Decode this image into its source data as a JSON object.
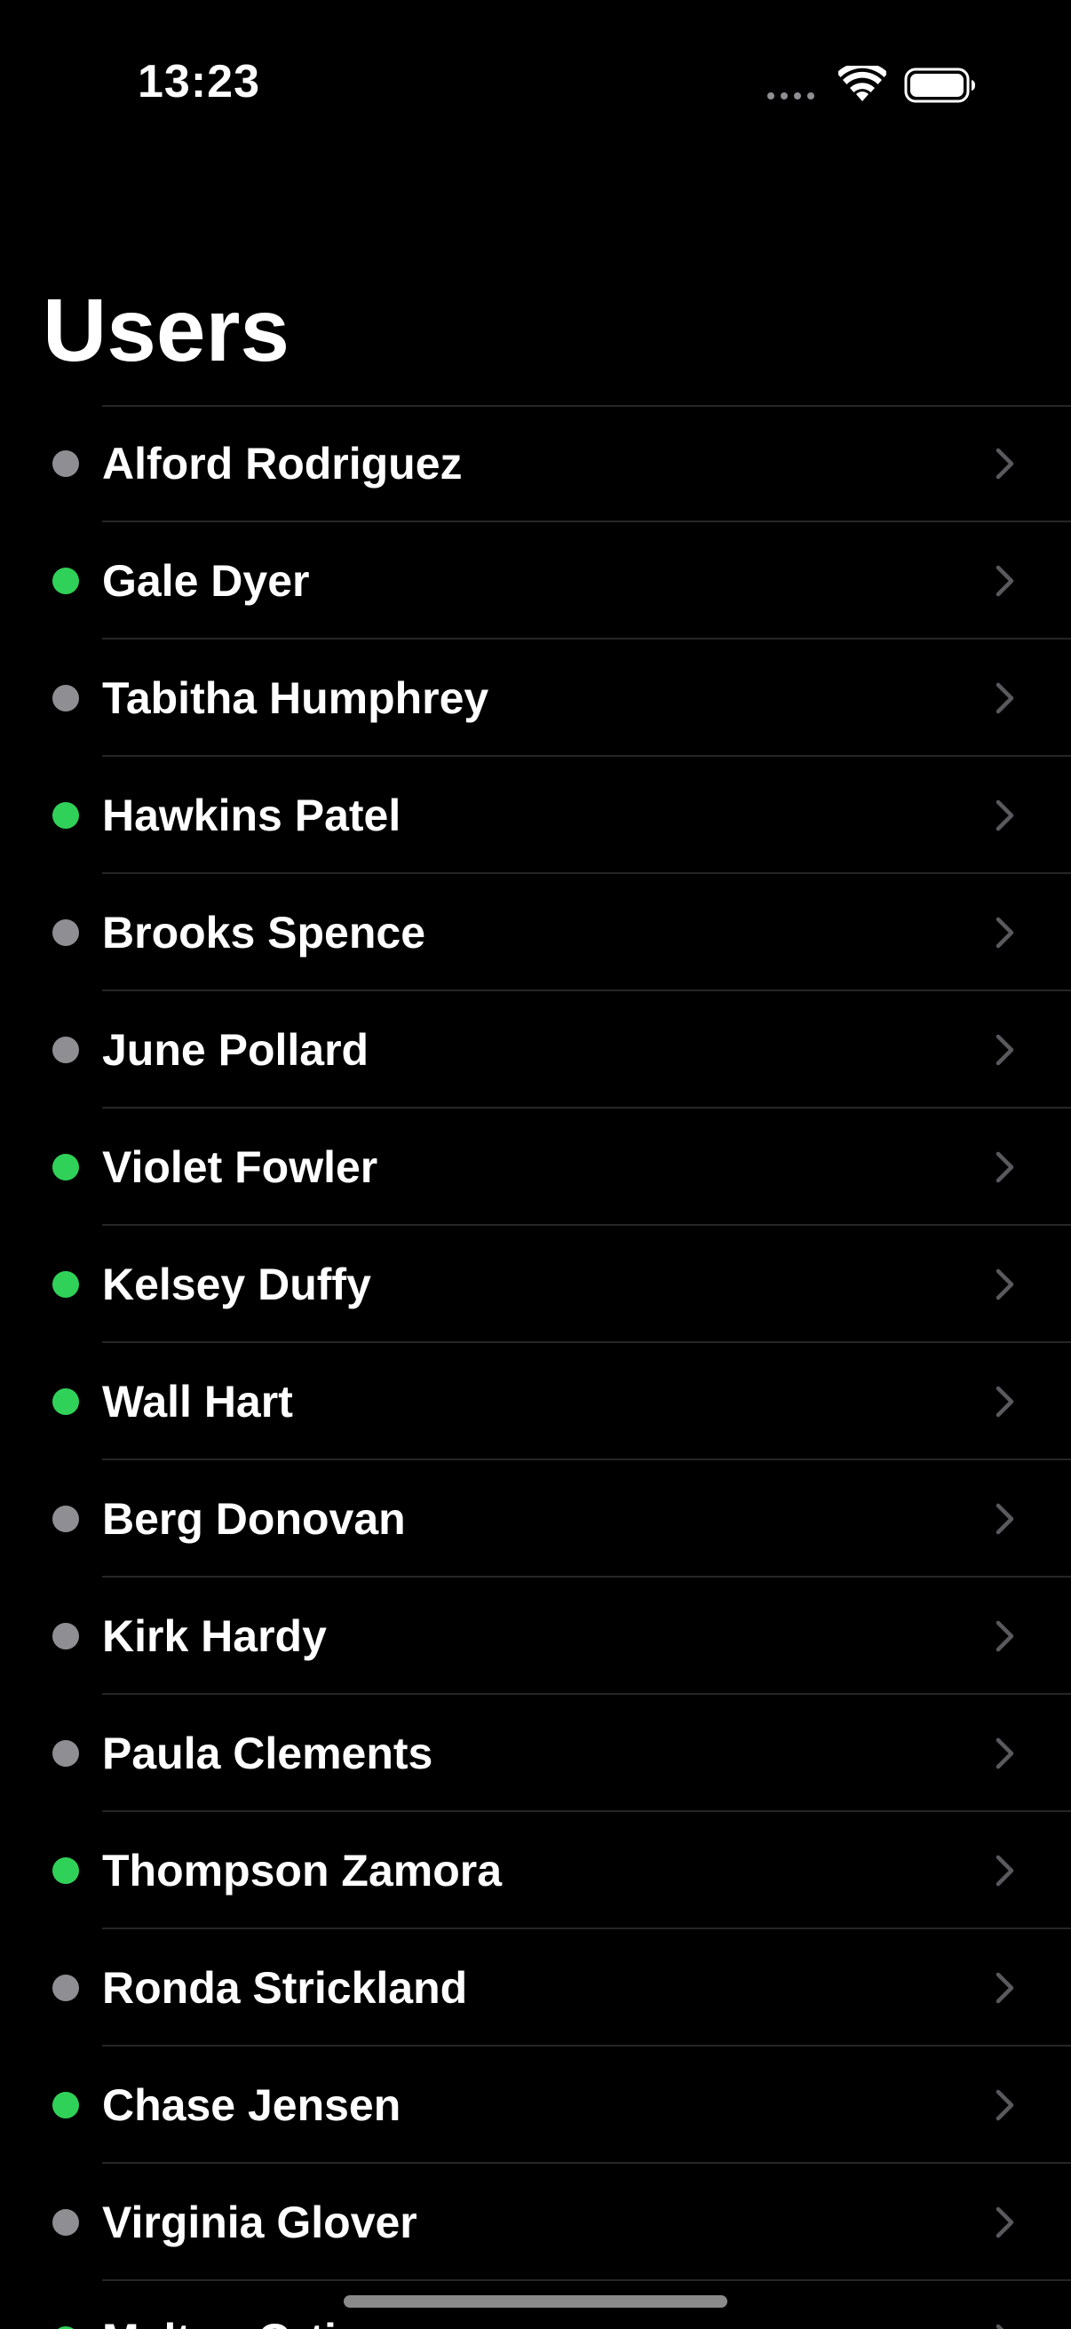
{
  "status_bar": {
    "time": "13:23",
    "wifi_icon": "wifi-icon",
    "battery_icon": "battery-icon"
  },
  "header": {
    "title": "Users"
  },
  "colors": {
    "online": "#30d158",
    "offline": "#8e8e93",
    "background": "#000000",
    "separator": "#262626",
    "chevron": "#5a5a5e"
  },
  "users": [
    {
      "name": "Alford Rodriguez",
      "status": "offline"
    },
    {
      "name": "Gale Dyer",
      "status": "online"
    },
    {
      "name": "Tabitha Humphrey",
      "status": "offline"
    },
    {
      "name": "Hawkins Patel",
      "status": "online"
    },
    {
      "name": "Brooks Spence",
      "status": "offline"
    },
    {
      "name": "June Pollard",
      "status": "offline"
    },
    {
      "name": "Violet Fowler",
      "status": "online"
    },
    {
      "name": "Kelsey Duffy",
      "status": "online"
    },
    {
      "name": "Wall Hart",
      "status": "online"
    },
    {
      "name": "Berg Donovan",
      "status": "offline"
    },
    {
      "name": "Kirk Hardy",
      "status": "offline"
    },
    {
      "name": "Paula Clements",
      "status": "offline"
    },
    {
      "name": "Thompson Zamora",
      "status": "online"
    },
    {
      "name": "Ronda Strickland",
      "status": "offline"
    },
    {
      "name": "Chase Jensen",
      "status": "online"
    },
    {
      "name": "Virginia Glover",
      "status": "offline"
    },
    {
      "name": "Melton Ortiz",
      "status": "online"
    }
  ]
}
